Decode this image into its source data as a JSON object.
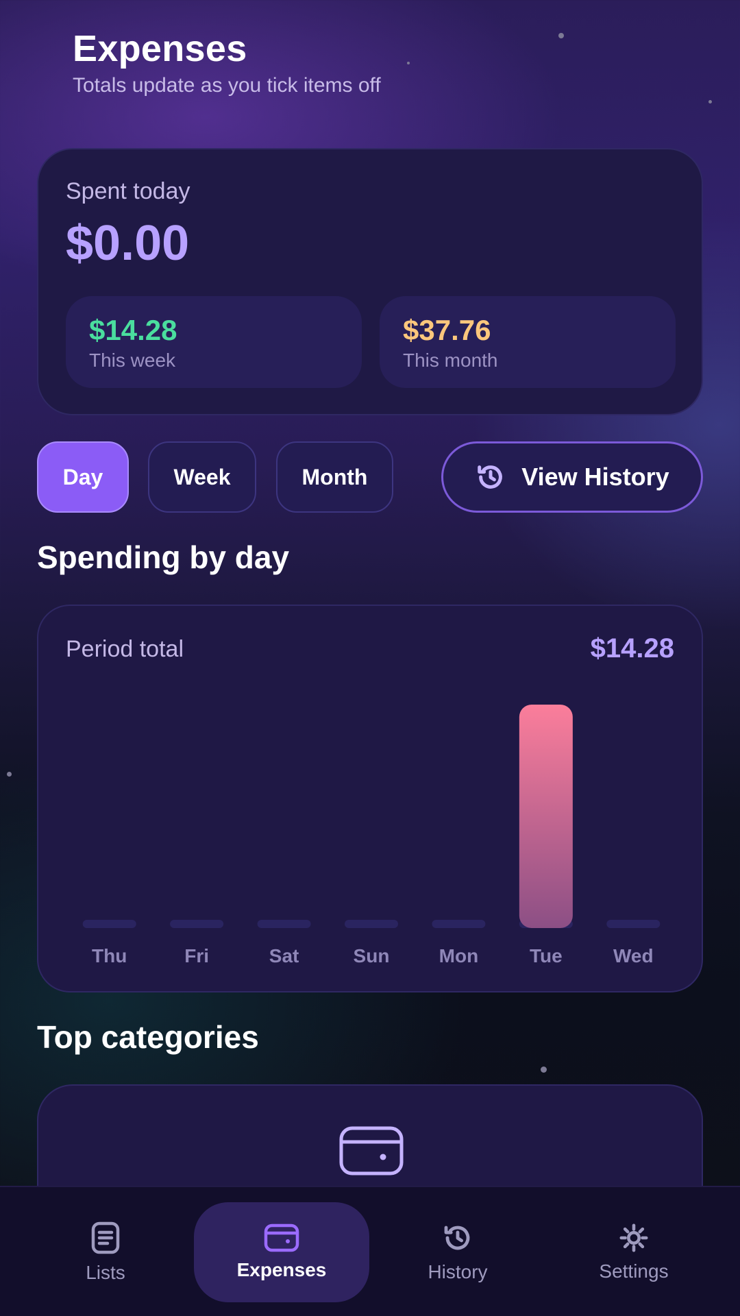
{
  "header": {
    "title": "Expenses",
    "subtitle": "Totals update as you tick items off"
  },
  "summary": {
    "spent_today_label": "Spent today",
    "spent_today_value": "$0.00",
    "week_value": "$14.28",
    "week_label": "This week",
    "month_value": "$37.76",
    "month_label": "This month"
  },
  "period_tabs": {
    "day": "Day",
    "week": "Week",
    "month": "Month",
    "selected": "Day"
  },
  "history_button": {
    "label": "View History",
    "icon": "history-icon"
  },
  "spending_section": {
    "title": "Spending by day"
  },
  "chart": {
    "period_label": "Period total",
    "period_value": "$14.28"
  },
  "chart_data": {
    "type": "bar",
    "categories": [
      "Thu",
      "Fri",
      "Sat",
      "Sun",
      "Mon",
      "Tue",
      "Wed"
    ],
    "values": [
      0,
      0,
      0,
      0,
      0,
      14.28,
      0
    ],
    "ylim": [
      0,
      14.28
    ],
    "grid": false
  },
  "categories_section": {
    "title": "Top categories",
    "icon": "wallet-icon"
  },
  "bottom_nav": {
    "items": [
      {
        "label": "Lists",
        "icon": "list-icon"
      },
      {
        "label": "Expenses",
        "icon": "wallet-icon"
      },
      {
        "label": "History",
        "icon": "history-icon"
      },
      {
        "label": "Settings",
        "icon": "gear-icon"
      }
    ],
    "active": "Expenses"
  },
  "colors": {
    "accent": "#8b5cf6",
    "primary_value": "#b7a1ff",
    "week_value": "#4ade9e",
    "month_value": "#fcc77c",
    "bar_top": "#fb7e9b",
    "bar_bottom": "#8c4f85"
  }
}
